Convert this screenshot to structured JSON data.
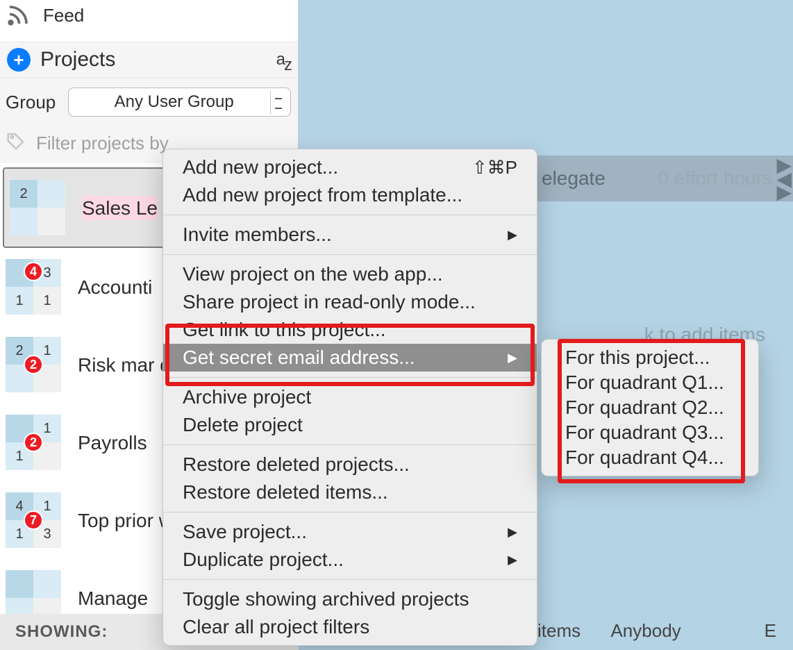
{
  "feed_label": "Feed",
  "projects_header": "Projects",
  "group_label": "Group",
  "group_selected": "Any User Group",
  "filter_placeholder": "Filter projects by",
  "showing_label": "SHOWING:",
  "projects": [
    {
      "label": "Sales Le",
      "quad": [
        "2",
        "",
        "",
        ""
      ],
      "badge": null,
      "selected": true
    },
    {
      "label": "Accounti",
      "quad": [
        "",
        "3",
        "1",
        "1"
      ],
      "badge": "4"
    },
    {
      "label": "Risk mar dashboa",
      "quad": [
        "2",
        "1",
        "",
        ""
      ],
      "badge": "2"
    },
    {
      "label": "Payrolls",
      "quad": [
        "",
        "1",
        "1",
        ""
      ],
      "badge": "2"
    },
    {
      "label": "Top prior with acti",
      "quad": [
        "4",
        "1",
        "1",
        "3"
      ],
      "badge": "7"
    },
    {
      "label": "Manage",
      "quad": [
        "",
        "",
        "",
        ""
      ],
      "badge": null
    }
  ],
  "workspace": {
    "effort": "0 effort hours",
    "delegate": "elegate",
    "add_hint": "k to add items",
    "items_label": "items",
    "anybody_label": "Anybody",
    "trailing_e": "E"
  },
  "ctx": {
    "add_project": "Add new project...",
    "shortcut": "⇧⌘P",
    "add_from_template": "Add new project from template...",
    "invite_members": "Invite members...",
    "view_web": "View project on the web app...",
    "share_readonly": "Share project in read-only mode...",
    "get_link": "Get link to this project...",
    "get_secret_email": "Get secret email address...",
    "archive": "Archive project",
    "delete": "Delete project",
    "restore_projects": "Restore deleted projects...",
    "restore_items": "Restore deleted items...",
    "save": "Save project...",
    "duplicate": "Duplicate project...",
    "toggle_archived": "Toggle showing archived projects",
    "clear_filters": "Clear all project filters"
  },
  "submenu": [
    "For this project...",
    "For quadrant Q1...",
    "For quadrant Q2...",
    "For quadrant Q3...",
    "For quadrant Q4..."
  ]
}
